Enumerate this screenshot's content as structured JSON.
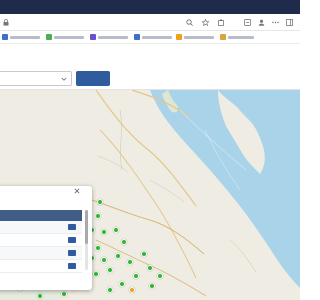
{
  "browser": {
    "address_text": "",
    "bookmarks": [
      {
        "label": "",
        "color": "#3b6fd6"
      },
      {
        "label": "",
        "color": "#4caf50"
      },
      {
        "label": "",
        "color": "#6a4fd1"
      },
      {
        "label": "",
        "color": "#3b6fd6"
      },
      {
        "label": "",
        "color": "#f0a020"
      },
      {
        "label": "",
        "color": "#d9a63a"
      }
    ]
  },
  "toolbar": {
    "layer_select_value": "",
    "run_button_label": ""
  },
  "popup": {
    "title": "",
    "columns": [
      "",
      ""
    ],
    "rows": [
      {
        "a": "",
        "b": ""
      },
      {
        "a": "",
        "b": ""
      },
      {
        "a": "",
        "b": ""
      },
      {
        "a": "",
        "b": ""
      }
    ]
  },
  "map": {
    "sea_color": "#a9d3e9",
    "land_color": "#efede3",
    "marker_colors": {
      "green": "#2eb82e",
      "orange": "#f0a020",
      "blue": "#2255cc",
      "red": "#dd3333"
    },
    "icons": [
      "close-icon",
      "chevron-down-icon",
      "lock-icon",
      "map-marker-icon"
    ]
  }
}
